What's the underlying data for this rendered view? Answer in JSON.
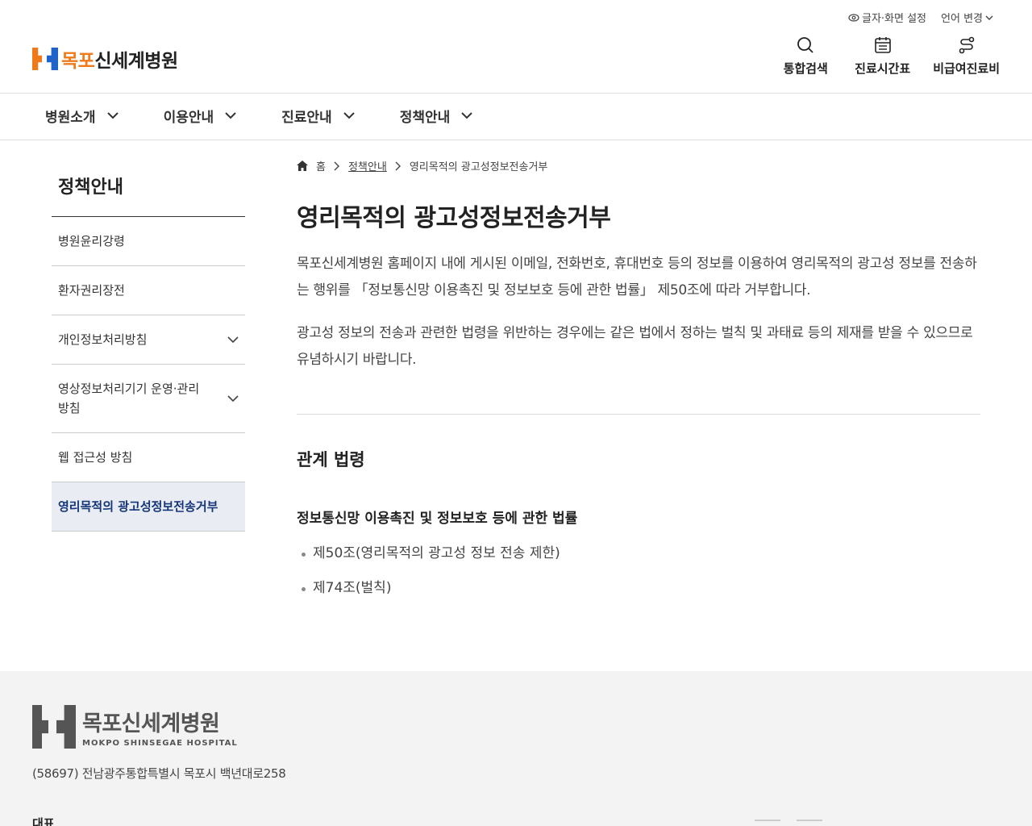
{
  "header": {
    "logo_text_a": "목포",
    "logo_text_b": "신세계병원",
    "util_font": "글자·화면 설정",
    "util_lang": "언어 변경",
    "quick": [
      {
        "label": "통합검색",
        "icon": "search-icon"
      },
      {
        "label": "진료시간표",
        "icon": "calendar-icon"
      },
      {
        "label": "비급여진료비",
        "icon": "route-icon"
      }
    ]
  },
  "nav": {
    "items": [
      "병원소개",
      "이용안내",
      "진료안내",
      "정책안내"
    ]
  },
  "sidebar": {
    "title": "정책안내",
    "items": [
      {
        "label": "병원윤리강령"
      },
      {
        "label": "환자권리장전"
      },
      {
        "label": "개인정보처리방침"
      },
      {
        "label": "영상정보처리기기 운영·관리 방침"
      },
      {
        "label": "웹 접근성 방침"
      },
      {
        "label": "영리목적의 광고성정보전송거부"
      }
    ]
  },
  "breadcrumb": {
    "home": "홈",
    "level1": "정책안내",
    "current": "영리목적의 광고성정보전송거부"
  },
  "content": {
    "title": "영리목적의 광고성정보전송거부",
    "para1": "목포신세계병원 홈페이지 내에 게시된 이메일, 전화번호, 휴대번호 등의 정보를 이용하여 영리목적의 광고성 정보를 전송하는 행위를 「정보통신망 이용촉진 및 정보보호 등에 관한 법률」 제50조에 따라 거부합니다.",
    "para2": "광고성 정보의 전송과 관련한 법령을 위반하는 경우에는 같은 법에서 정하는 벌칙 및 과태료 등의 제재를 받을 수 있으므로 유념하시기 바랍니다.",
    "section_title": "관계 법령",
    "law_title": "정보통신망 이용촉진 및 정보보호 등에 관한 법률",
    "law_items": [
      "제50조(영리목적의 광고성 정보 전송 제한)",
      "제74조(벌칙)"
    ]
  },
  "footer": {
    "logo_kr": "목포신세계병원",
    "logo_en": "MOKPO SHINSEGAE HOSPITAL",
    "address": "(58697) 전남광주통합특별시 목포시 백년대로258",
    "rep_label": "대표"
  },
  "colors": {
    "brand_orange": "#f07a1a",
    "brand_blue": "#1f63c9",
    "active_bg": "#e9edf3",
    "active_text": "#14357a"
  }
}
